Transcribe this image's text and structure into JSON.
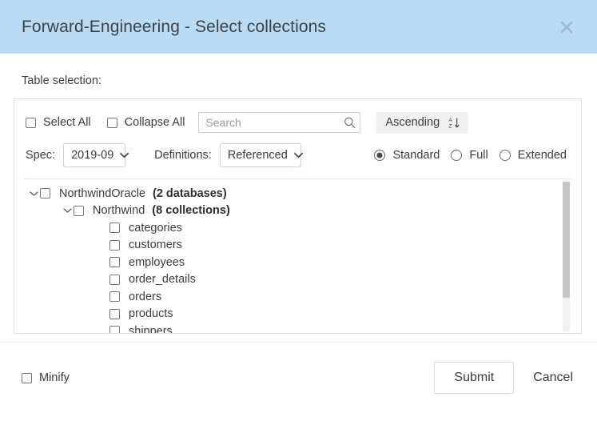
{
  "header": {
    "title": "Forward-Engineering - Select collections",
    "close_icon": "close-icon",
    "background_color": "#b9dbf5"
  },
  "body": {
    "section_label": "Table selection:"
  },
  "toolbar": {
    "select_all_label": "Select All",
    "collapse_all_label": "Collapse All",
    "search": {
      "value": "",
      "placeholder": "Search",
      "icon": "search-icon"
    },
    "sort": {
      "label": "Ascending",
      "icon": "sort-alpha-ascending-icon"
    },
    "spec": {
      "label": "Spec:",
      "value": "2019-09",
      "icon": "chevron-down-icon"
    },
    "definitions": {
      "label": "Definitions:",
      "value": "Referenced",
      "icon": "chevron-down-icon"
    },
    "mode_options": [
      {
        "label": "Standard",
        "selected": true
      },
      {
        "label": "Full",
        "selected": false
      },
      {
        "label": "Extended",
        "selected": false
      }
    ]
  },
  "tree": {
    "nodes": [
      {
        "name": "NorthwindOracle",
        "count": "(2 databases)",
        "level": 0,
        "expanded": true,
        "checked": false
      },
      {
        "name": "Northwind",
        "count": "(8 collections)",
        "level": 1,
        "expanded": true,
        "checked": false
      },
      {
        "name": "categories",
        "level": 2,
        "checked": false
      },
      {
        "name": "customers",
        "level": 2,
        "checked": false
      },
      {
        "name": "employees",
        "level": 2,
        "checked": false
      },
      {
        "name": "order_details",
        "level": 2,
        "checked": false
      },
      {
        "name": "orders",
        "level": 2,
        "checked": false
      },
      {
        "name": "products",
        "level": 2,
        "checked": false
      },
      {
        "name": "shippers",
        "level": 2,
        "checked": false
      }
    ]
  },
  "footer": {
    "minify_label": "Minify",
    "submit_label": "Submit",
    "cancel_label": "Cancel"
  }
}
